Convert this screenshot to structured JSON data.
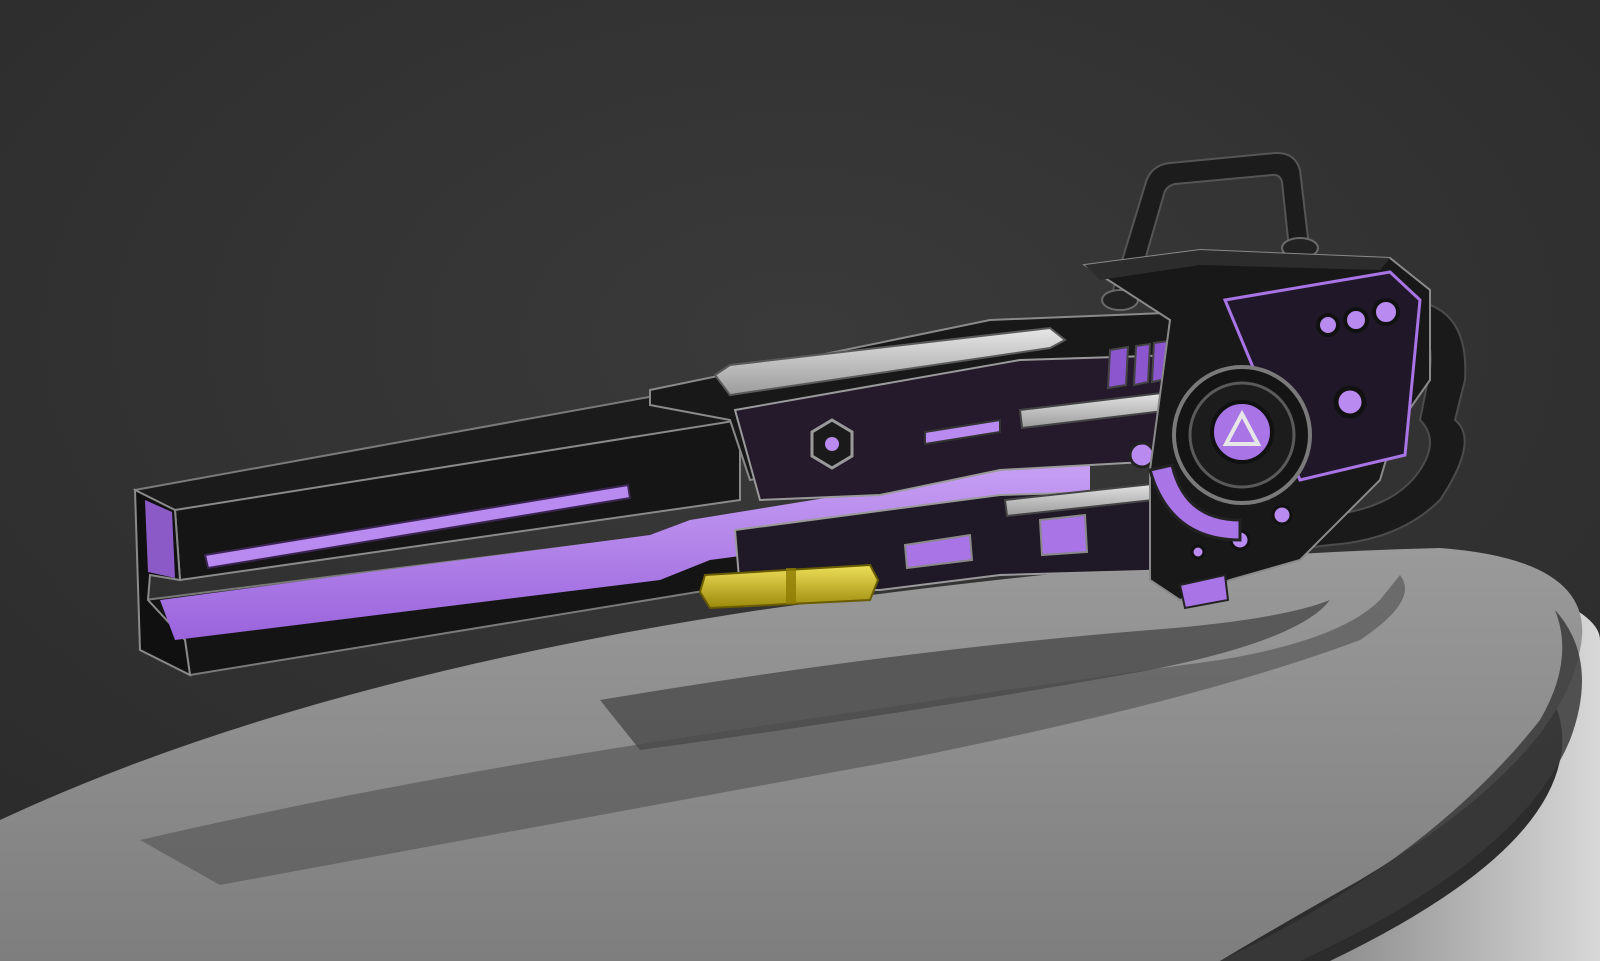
{
  "scene": {
    "subject": "sci-fi-energy-rifle",
    "colors": {
      "background": "#333333",
      "body_dark": "#161616",
      "body_edge": "#8a8a8a",
      "glow": "#a874e6",
      "glow_light": "#c9a3f5",
      "metal_plate": "#cfcfcf",
      "canister": "#d6c21a",
      "pedestal_top": "#8d8d8d",
      "pedestal_side": "#cfcfcf"
    }
  }
}
